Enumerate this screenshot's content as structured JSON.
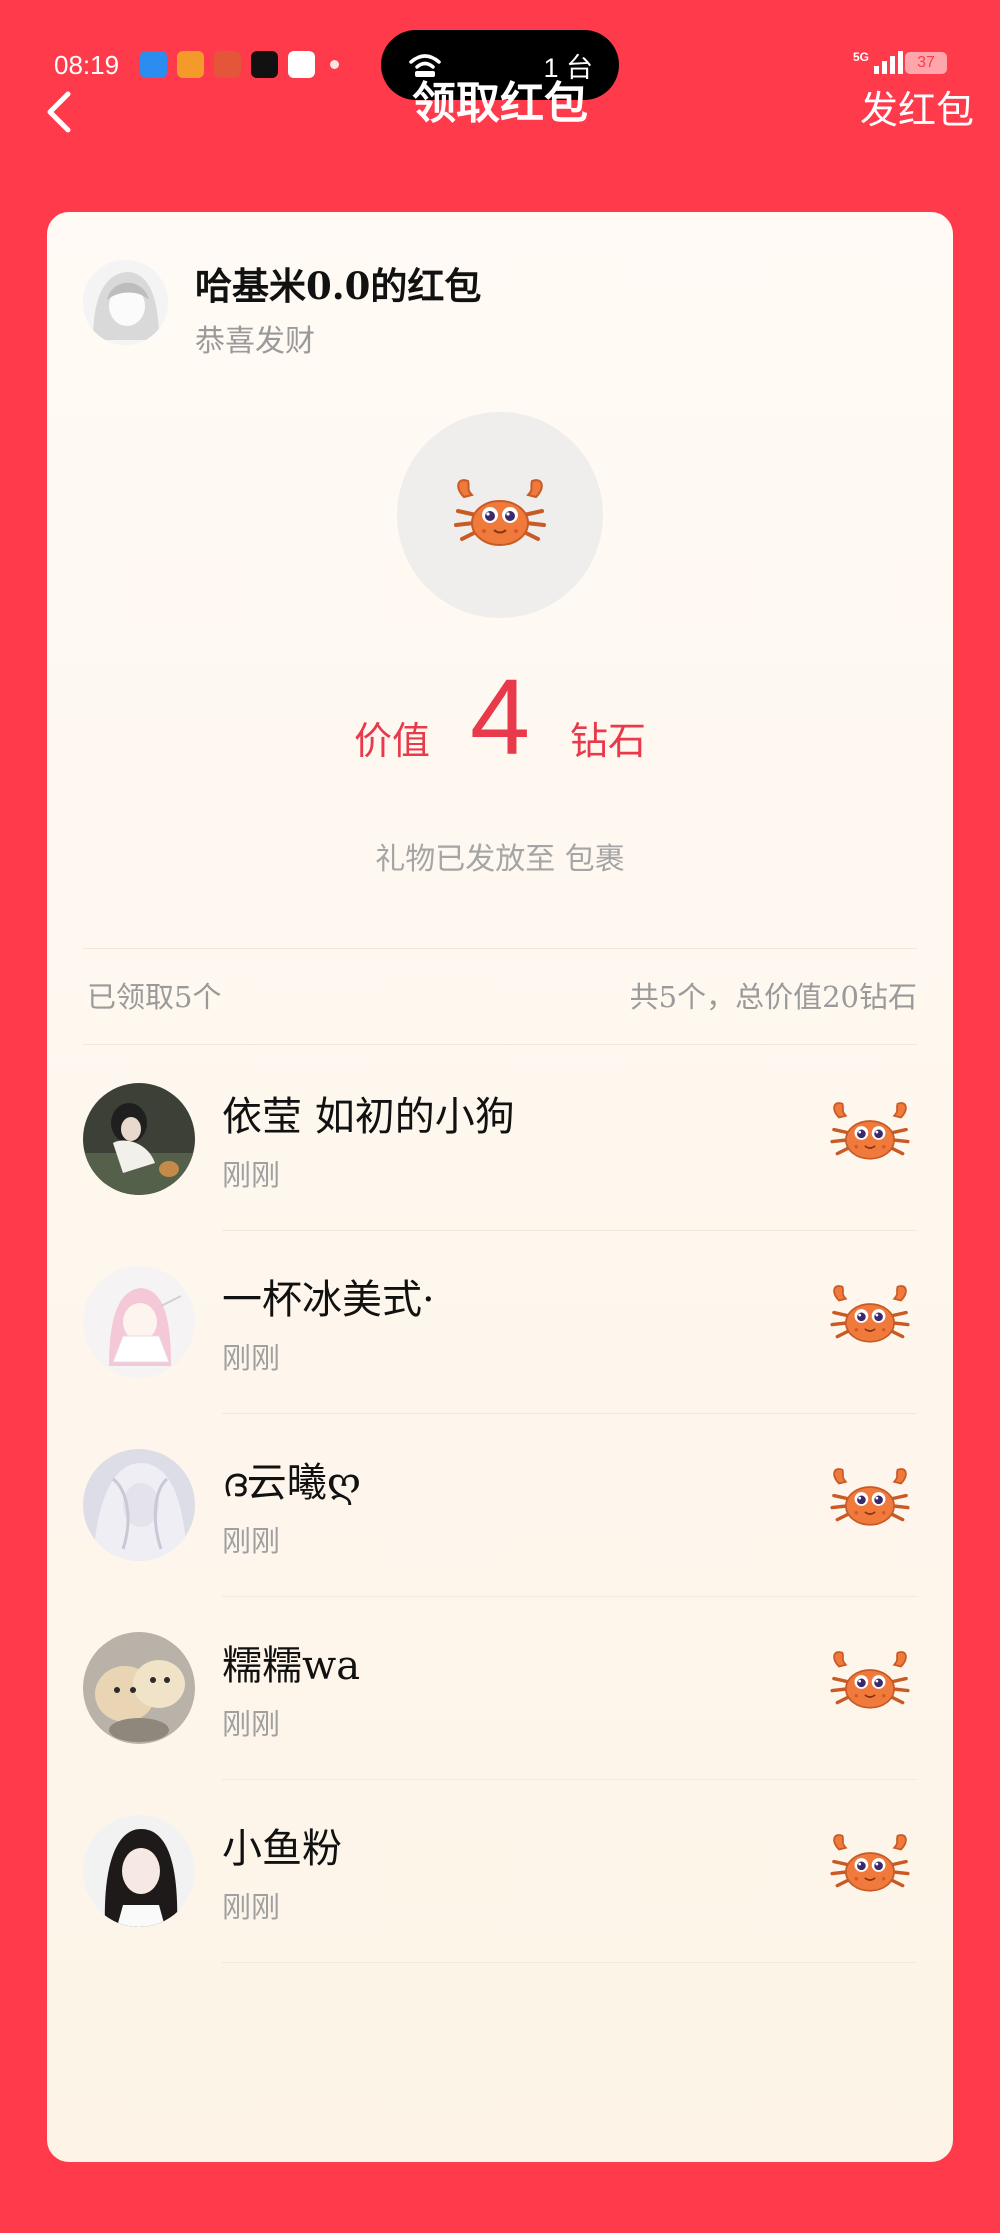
{
  "status_bar": {
    "time": "08:19",
    "island_text": "1 台",
    "network": "5G",
    "battery": "37"
  },
  "nav": {
    "title": "领取红包",
    "send_label": "发红包"
  },
  "sender": {
    "name": "哈基米0.0的红包",
    "wish": "恭喜发财"
  },
  "gift": {
    "icon": "crab-icon",
    "value_label": "价值",
    "value": "4",
    "unit": "钻石",
    "note": "礼物已发放至 包裹"
  },
  "summary": {
    "claimed": "已领取5个",
    "total": "共5个，总价值20钻石"
  },
  "recipients": [
    {
      "name": "依莹 如初的小狗",
      "time": "刚刚"
    },
    {
      "name": "一杯冰美式·",
      "time": "刚刚"
    },
    {
      "name": "ദ云曦ღ",
      "time": "刚刚"
    },
    {
      "name": "糯糯wa",
      "time": "刚刚"
    },
    {
      "name": "小鱼粉",
      "time": "刚刚"
    }
  ],
  "colors": {
    "background": "#ff3a4a",
    "accent": "#e83a4b",
    "card": "#fdf6ec"
  }
}
